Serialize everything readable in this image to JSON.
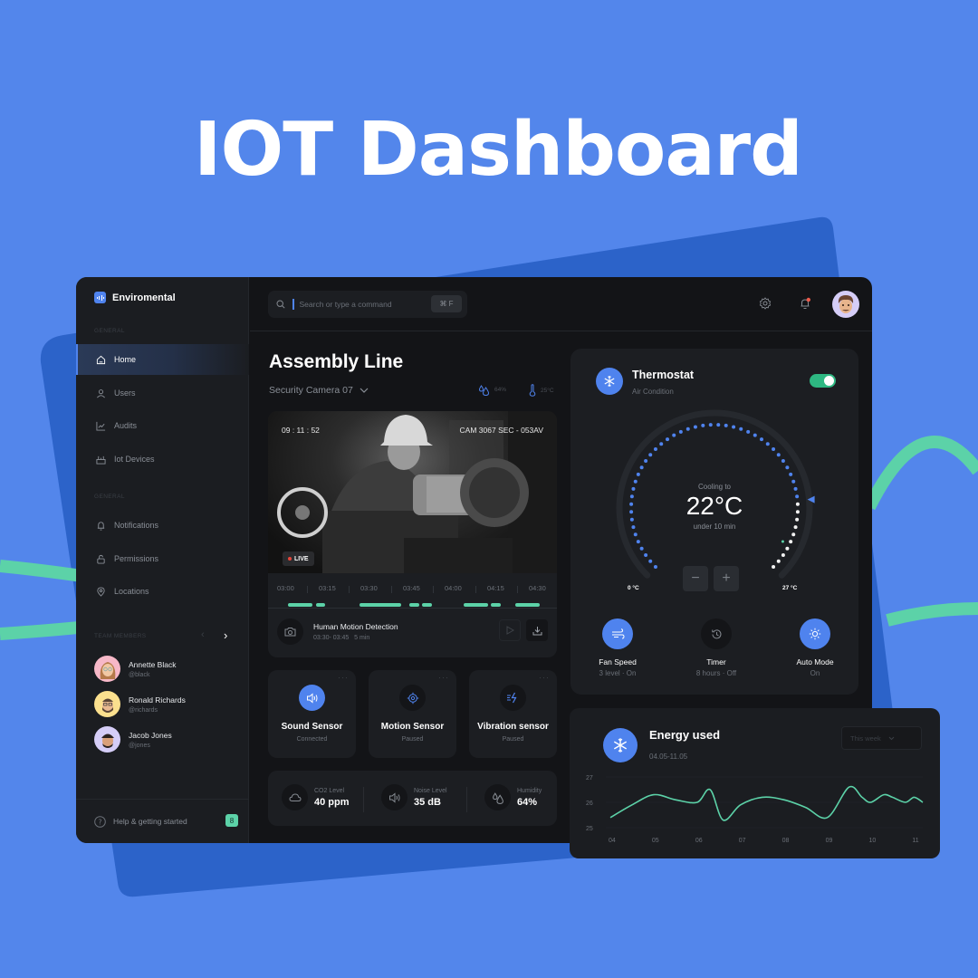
{
  "hero_title": "IOT Dashboard",
  "colors": {
    "accent": "#4f83ee",
    "green": "#5cd2a8",
    "toggle": "#2eb882",
    "background": "#5386eb"
  },
  "sidebar": {
    "brand": "Enviromental",
    "section_1": "GENERAL",
    "items_1": [
      {
        "label": "Home",
        "icon": "home-icon",
        "active": true
      },
      {
        "label": "Users",
        "icon": "user-icon"
      },
      {
        "label": "Audits",
        "icon": "chart-icon"
      },
      {
        "label": "Iot Devices",
        "icon": "devices-icon"
      }
    ],
    "section_2": "GENERAL",
    "items_2": [
      {
        "label": "Notifications",
        "icon": "bell-icon"
      },
      {
        "label": "Permissions",
        "icon": "lock-icon"
      },
      {
        "label": "Locations",
        "icon": "location-icon"
      }
    ],
    "team_label": "TEAM MEMBERS",
    "team": [
      {
        "name": "Annette Black",
        "handle": "@black"
      },
      {
        "name": "Ronald Richards",
        "handle": "@richards"
      },
      {
        "name": "Jacob Jones",
        "handle": "@jones"
      }
    ],
    "help": "Help & getting started",
    "help_badge": "8"
  },
  "topbar": {
    "search_placeholder": "Search or type a command",
    "shortcut": "⌘ F"
  },
  "main": {
    "title": "Assembly Line",
    "camera_select": "Security Camera 07",
    "humidity": "64%",
    "temperature": "25°C",
    "camera": {
      "time": "09 : 11 : 52",
      "cam_id": "CAM 3067 SEC - 053AV",
      "live": "LIVE",
      "timeline": [
        "03:00",
        "03:15",
        "03:30",
        "03:45",
        "04:00",
        "04:15",
        "04:30"
      ],
      "event_title": "Human Motion Detection",
      "event_time": "03:30- 03:45",
      "event_duration": "5 min"
    },
    "sensors": [
      {
        "name": "Sound Sensor",
        "status": "Connected",
        "active": true
      },
      {
        "name": "Motion Sensor",
        "status": "Paused"
      },
      {
        "name": "Vibration sensor",
        "status": "Paused"
      }
    ],
    "metrics": [
      {
        "label": "CO2 Level",
        "value": "40 ppm"
      },
      {
        "label": "Noise Level",
        "value": "35 dB"
      },
      {
        "label": "Humidity",
        "value": "64%"
      }
    ]
  },
  "thermostat": {
    "title": "Thermostat",
    "subtitle": "Air Condition",
    "enabled": true,
    "status": "Cooling to",
    "target": "22°C",
    "eta": "under 10 min",
    "min_label": "0 °C",
    "max_label": "27 °C",
    "target_value": 22,
    "range": [
      0,
      27
    ],
    "modes": [
      {
        "name": "Fan Speed",
        "status": "3 level · On",
        "active": true
      },
      {
        "name": "Timer",
        "status": "8 hours · Off"
      },
      {
        "name": "Auto Mode",
        "status": "On",
        "active": true
      }
    ],
    "minus": "−",
    "plus": "+"
  },
  "energy": {
    "title": "Energy used",
    "range": "04.05-11.05",
    "period": "This week"
  },
  "chart_data": {
    "type": "line",
    "title": "Energy used",
    "x": [
      4,
      4.5,
      5,
      5.5,
      6,
      6.3,
      6.6,
      7,
      7.5,
      8,
      8.5,
      9,
      9.5,
      9.8,
      10,
      10.3,
      10.5,
      10.8,
      11,
      11.2
    ],
    "xticks": [
      "04",
      "05",
      "06",
      "07",
      "08",
      "09",
      "10",
      "11"
    ],
    "yticks": [
      "25",
      "26",
      "27"
    ],
    "series": [
      {
        "name": "Energy",
        "values": [
          25.4,
          25.9,
          26.3,
          26.1,
          26.0,
          26.5,
          25.3,
          25.9,
          26.2,
          26.1,
          25.8,
          25.4,
          26.6,
          26.2,
          26.0,
          26.3,
          26.2,
          26.0,
          26.2,
          26.0
        ]
      }
    ],
    "ylim": [
      25,
      27
    ],
    "grid": true
  }
}
